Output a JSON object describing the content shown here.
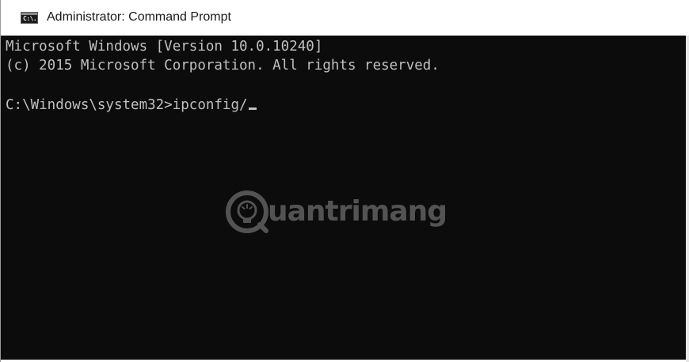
{
  "window": {
    "title": "Administrator: Command Prompt",
    "icon_name": "cmd-icon",
    "icon_glyph": "C:\\."
  },
  "console": {
    "lines": [
      "Microsoft Windows [Version 10.0.10240]",
      "(c) 2015 Microsoft Corporation. All rights reserved.",
      "C:\\Windows\\system32>ipconfig/"
    ],
    "foreground": "#c0c0c0",
    "background": "#0c0c0c"
  },
  "watermark": {
    "text": "uantrimang",
    "logo_name": "quantrimang-logo-icon"
  }
}
